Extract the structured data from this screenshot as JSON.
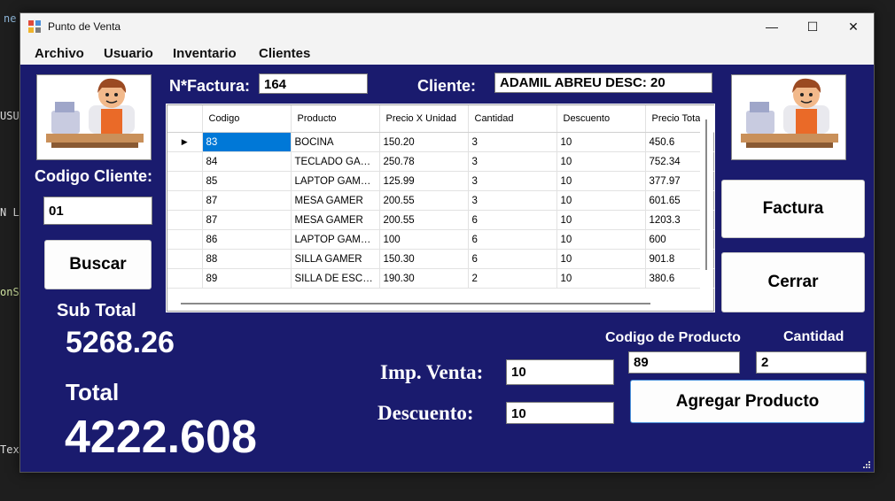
{
  "background": {
    "fragments": [
      "ne",
      "USU",
      "N L",
      "onS",
      "Tex"
    ]
  },
  "window": {
    "title": "Punto de Venta",
    "controls": [
      "—",
      "☐",
      "✕"
    ]
  },
  "menu": [
    "Archivo",
    "Usuario",
    "Inventario",
    "Clientes"
  ],
  "invoice": {
    "label": "N*Factura:",
    "value": "164"
  },
  "client": {
    "label": "Cliente:",
    "value": "ADAMIL ABREU DESC: 20"
  },
  "client_code": {
    "label": "Codigo Cliente:",
    "value": "01"
  },
  "buttons": {
    "search": "Buscar",
    "invoice": "Factura",
    "close": "Cerrar",
    "add_product": "Agregar Producto"
  },
  "grid": {
    "columns": [
      "Codigo",
      "Producto",
      "Precio X Unidad",
      "Cantidad",
      "Descuento",
      "Precio Total"
    ],
    "rows": [
      [
        "83",
        "BOCINA",
        "150.20",
        "3",
        "10",
        "450.6"
      ],
      [
        "84",
        "TECLADO GAMER",
        "250.78",
        "3",
        "10",
        "752.34"
      ],
      [
        "85",
        "LAPTOP GAME...",
        "125.99",
        "3",
        "10",
        "377.97"
      ],
      [
        "87",
        "MESA GAMER",
        "200.55",
        "3",
        "10",
        "601.65"
      ],
      [
        "87",
        "MESA GAMER",
        "200.55",
        "6",
        "10",
        "1203.3"
      ],
      [
        "86",
        "LAPTOP GAME...",
        "100",
        "6",
        "10",
        "600"
      ],
      [
        "88",
        "SILLA GAMER",
        "150.30",
        "6",
        "10",
        "901.8"
      ],
      [
        "89",
        "SILLA DE ESCRI...",
        "190.30",
        "2",
        "10",
        "380.6"
      ]
    ]
  },
  "totals": {
    "subtotal_label": "Sub Total",
    "subtotal_value": "5268.26",
    "total_label": "Total",
    "total_value": "4222.608"
  },
  "tax": {
    "label": "Imp. Venta:",
    "value": "10"
  },
  "discount": {
    "label": "Descuento:",
    "value": "10"
  },
  "product_code": {
    "label": "Codigo de Producto",
    "value": "89"
  },
  "quantity": {
    "label": "Cantidad",
    "value": "2"
  }
}
